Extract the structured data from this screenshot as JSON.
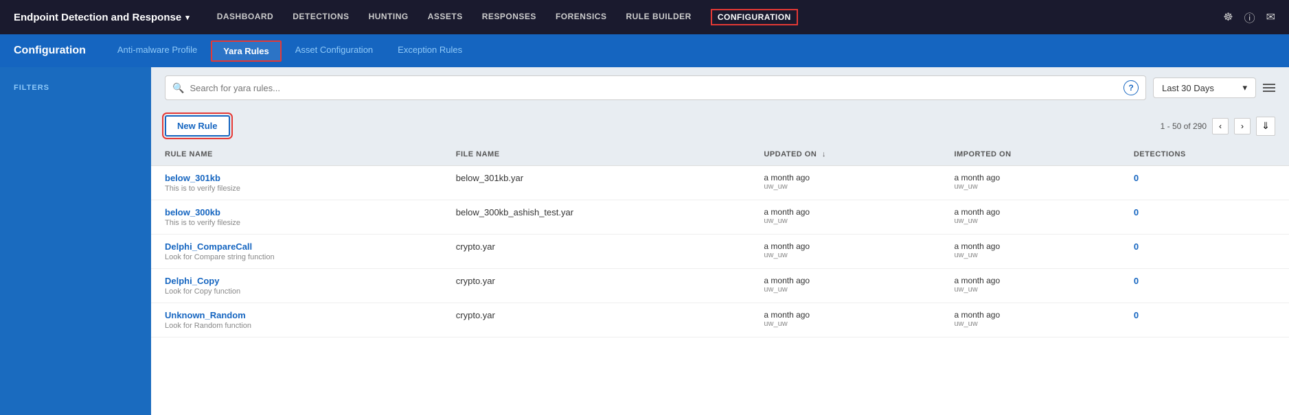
{
  "app": {
    "title": "Endpoint Detection and Response",
    "chevron": "▾"
  },
  "nav": {
    "items": [
      {
        "id": "dashboard",
        "label": "DASHBOARD",
        "active": false
      },
      {
        "id": "detections",
        "label": "DETECTIONS",
        "active": false
      },
      {
        "id": "hunting",
        "label": "HUNTING",
        "active": false
      },
      {
        "id": "assets",
        "label": "ASSETS",
        "active": false
      },
      {
        "id": "responses",
        "label": "RESPONSES",
        "active": false
      },
      {
        "id": "forensics",
        "label": "FORENSICS",
        "active": false
      },
      {
        "id": "rule-builder",
        "label": "RULE BUILDER",
        "active": false
      },
      {
        "id": "configuration",
        "label": "CONFIGURATION",
        "active": true
      }
    ]
  },
  "sub_header": {
    "title": "Configuration",
    "tabs": [
      {
        "id": "anti-malware",
        "label": "Anti-malware Profile",
        "active": false
      },
      {
        "id": "yara-rules",
        "label": "Yara Rules",
        "active": true
      },
      {
        "id": "asset-config",
        "label": "Asset Configuration",
        "active": false
      },
      {
        "id": "exception-rules",
        "label": "Exception Rules",
        "active": false
      }
    ]
  },
  "sidebar": {
    "filters_label": "FILTERS"
  },
  "search": {
    "placeholder": "Search for yara rules..."
  },
  "date_filter": {
    "label": "Last 30 Days",
    "chevron": "▾"
  },
  "toolbar": {
    "new_rule_label": "New Rule"
  },
  "pagination": {
    "range": "1 - 50 of 290",
    "prev": "‹",
    "next": "›"
  },
  "table": {
    "columns": [
      {
        "id": "rule-name",
        "label": "RULE NAME",
        "sortable": false
      },
      {
        "id": "file-name",
        "label": "FILE NAME",
        "sortable": false
      },
      {
        "id": "updated-on",
        "label": "UPDATED ON",
        "sortable": true
      },
      {
        "id": "imported-on",
        "label": "IMPORTED ON",
        "sortable": false
      },
      {
        "id": "detections",
        "label": "DETECTIONS",
        "sortable": false
      }
    ],
    "rows": [
      {
        "rule_name": "below_301kb",
        "rule_desc": "This is to verify filesize",
        "file_name": "below_301kb.yar",
        "updated_time": "a month ago",
        "updated_user": "uw_uw",
        "imported_time": "a month ago",
        "imported_user": "uw_uw",
        "detections": "0"
      },
      {
        "rule_name": "below_300kb",
        "rule_desc": "This is to verify filesize",
        "file_name": "below_300kb_ashish_test.yar",
        "updated_time": "a month ago",
        "updated_user": "uw_uw",
        "imported_time": "a month ago",
        "imported_user": "uw_uw",
        "detections": "0"
      },
      {
        "rule_name": "Delphi_CompareCall",
        "rule_desc": "Look for Compare string function",
        "file_name": "crypto.yar",
        "updated_time": "a month ago",
        "updated_user": "uw_uw",
        "imported_time": "a month ago",
        "imported_user": "uw_uw",
        "detections": "0"
      },
      {
        "rule_name": "Delphi_Copy",
        "rule_desc": "Look for Copy function",
        "file_name": "crypto.yar",
        "updated_time": "a month ago",
        "updated_user": "uw_uw",
        "imported_time": "a month ago",
        "imported_user": "uw_uw",
        "detections": "0"
      },
      {
        "rule_name": "Unknown_Random",
        "rule_desc": "Look for Random function",
        "file_name": "crypto.yar",
        "updated_time": "a month ago",
        "updated_user": "uw_uw",
        "imported_time": "a month ago",
        "imported_user": "uw_uw",
        "detections": "0"
      }
    ]
  }
}
